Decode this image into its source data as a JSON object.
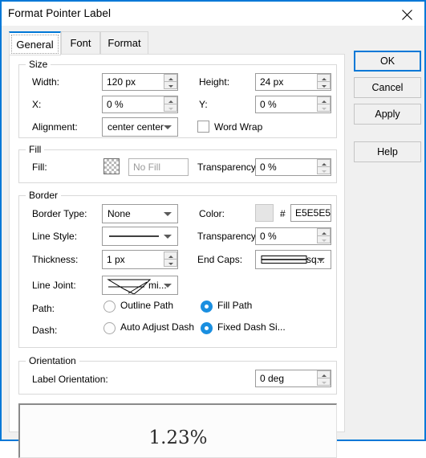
{
  "window": {
    "title": "Format Pointer Label",
    "close_icon": "close-icon"
  },
  "tabs": [
    {
      "label": "General",
      "active": true
    },
    {
      "label": "Font",
      "active": false
    },
    {
      "label": "Format",
      "active": false
    }
  ],
  "groups": {
    "size": {
      "title": "Size",
      "width_label": "Width:",
      "width_value": "120 px",
      "height_label": "Height:",
      "height_value": "24 px",
      "x_label": "X:",
      "x_value": "0 %",
      "y_label": "Y:",
      "y_value": "0 %",
      "alignment_label": "Alignment:",
      "alignment_value": "center center",
      "word_wrap_label": "Word Wrap",
      "word_wrap_checked": false
    },
    "fill": {
      "title": "Fill",
      "fill_label": "Fill:",
      "fill_swatch": "transparent-checker",
      "fill_value": "No Fill",
      "transparency_label": "Transparency:",
      "transparency_value": "0 %"
    },
    "border": {
      "title": "Border",
      "border_type_label": "Border Type:",
      "border_type_value": "None",
      "color_label": "Color:",
      "color_hash": "#",
      "color_hex": "E5E5E5",
      "color_swatch": "E5E5E5",
      "line_style_label": "Line Style:",
      "line_style_value": "",
      "transparency_label": "Transparency:",
      "transparency_value": "0 %",
      "thickness_label": "Thickness:",
      "thickness_value": "1 px",
      "end_caps_label": "End Caps:",
      "end_caps_value": "sq...",
      "line_joint_label": "Line Joint:",
      "line_joint_value": "mi...",
      "path_label": "Path:",
      "path_options": [
        {
          "label": "Outline Path",
          "selected": false
        },
        {
          "label": "Fill Path",
          "selected": true
        }
      ],
      "dash_label": "Dash:",
      "dash_options": [
        {
          "label": "Auto Adjust Dash",
          "selected": false
        },
        {
          "label": "Fixed Dash Si...",
          "selected": true
        }
      ]
    },
    "orientation": {
      "title": "Orientation",
      "label_orientation_label": "Label Orientation:",
      "label_orientation_value": "0 deg"
    }
  },
  "preview": {
    "text": "1.23%"
  },
  "buttons": [
    {
      "label": "OK",
      "default": true
    },
    {
      "label": "Cancel",
      "default": false
    },
    {
      "label": "Apply",
      "default": false
    },
    {
      "label": "Help",
      "default": false
    }
  ],
  "colors": {
    "accent": "#0078D7",
    "radio_selected": "#1A8FE0",
    "dialog_bg": "#F0F0F0",
    "panel_bg": "#FFFFFF",
    "border_color_swatch": "#E5E5E5"
  }
}
